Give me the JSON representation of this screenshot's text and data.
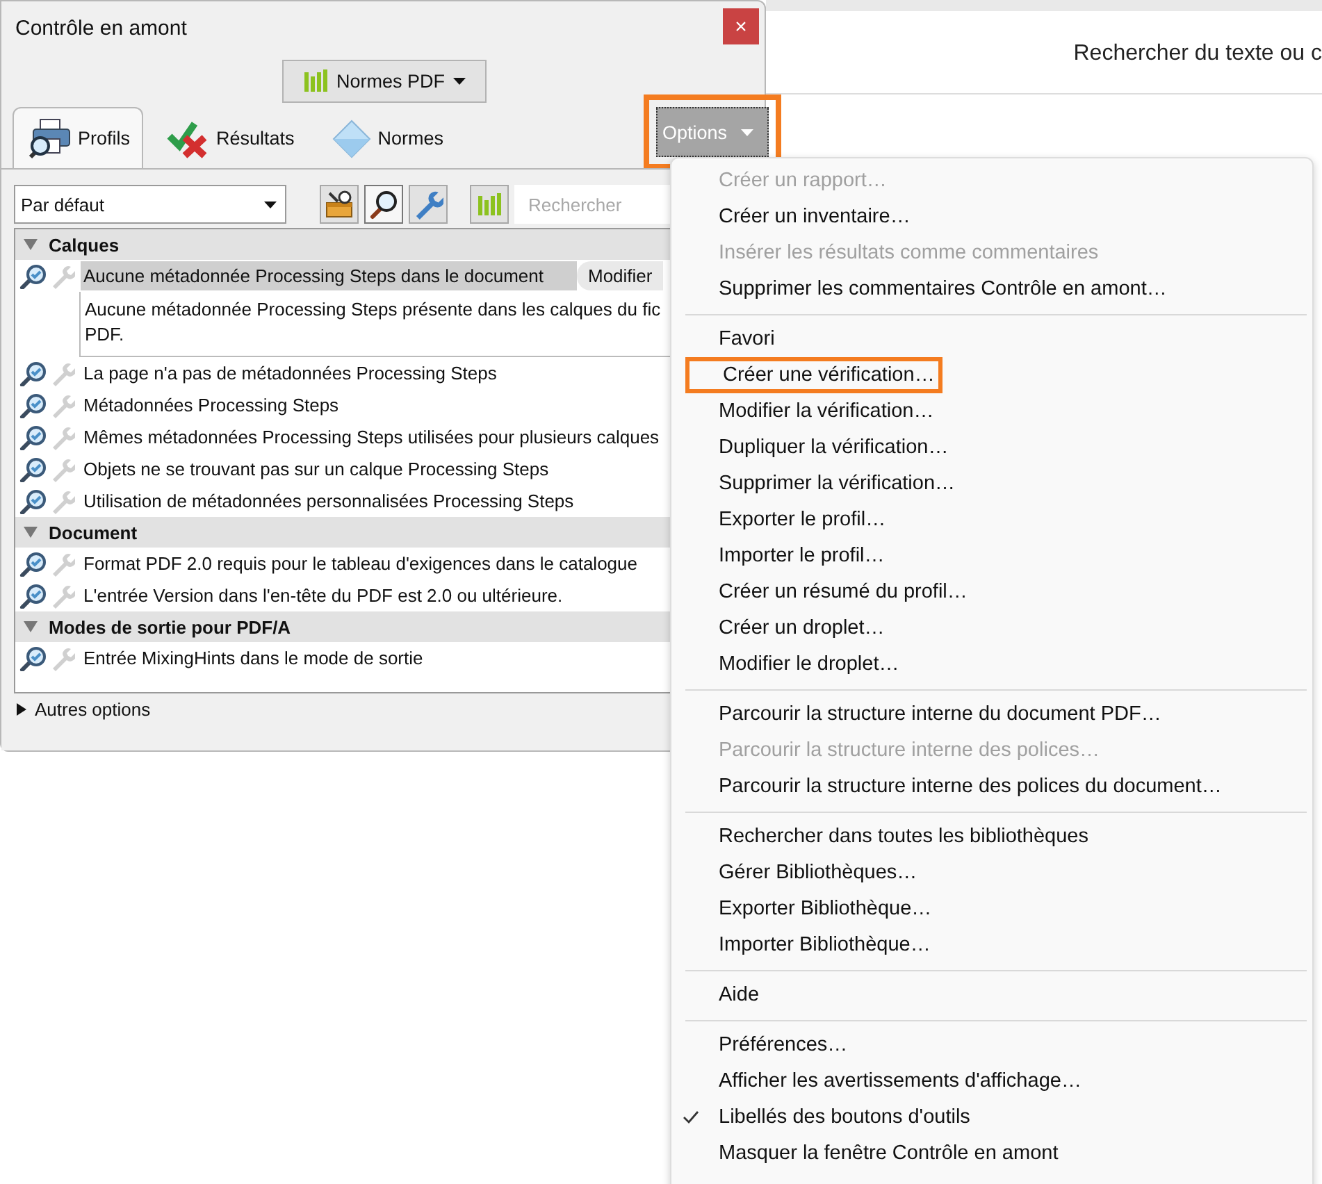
{
  "panel": {
    "title": "Contrôle en amont",
    "close_label": "×",
    "library_button": {
      "label": "Normes PDF"
    },
    "tabs": [
      {
        "label": "Profils",
        "kind": "profiles",
        "selected": true
      },
      {
        "label": "Résultats",
        "kind": "results",
        "selected": false
      },
      {
        "label": "Normes",
        "kind": "standards",
        "selected": false
      }
    ],
    "options_button": {
      "label": "Options",
      "annotated": true
    },
    "profile_select": {
      "value": "Par défaut"
    },
    "toolbar": [
      {
        "kind": "toolbox",
        "selected": false
      },
      {
        "kind": "search",
        "selected": true
      },
      {
        "kind": "wrench",
        "selected": false
      }
    ],
    "search": {
      "placeholder": "Rechercher"
    },
    "groups": [
      {
        "title": "Calques",
        "expanded": true,
        "items": [
          {
            "label": "Aucune métadonnée Processing Steps dans le document",
            "selected": true,
            "action": "Modifier",
            "description_lines": [
              "Aucune métadonnée Processing Steps présente dans les calques du fic",
              "PDF."
            ]
          },
          {
            "label": "La page n'a pas de métadonnées Processing Steps",
            "selected": false
          },
          {
            "label": "Métadonnées Processing Steps",
            "selected": false
          },
          {
            "label": "Mêmes métadonnées Processing Steps utilisées pour plusieurs calques",
            "selected": false
          },
          {
            "label": "Objets ne se trouvant pas sur un calque Processing Steps",
            "selected": false
          },
          {
            "label": "Utilisation de métadonnées personnalisées Processing Steps",
            "selected": false
          }
        ]
      },
      {
        "title": "Document",
        "expanded": true,
        "items": [
          {
            "label": "Format PDF 2.0 requis pour le tableau d'exigences dans le catalogue",
            "selected": false
          },
          {
            "label": "L'entrée Version dans l'en-tête du PDF est 2.0 ou ultérieure.",
            "selected": false
          }
        ]
      },
      {
        "title": "Modes de sortie pour PDF/A",
        "expanded": true,
        "items": [
          {
            "label": "Entrée MixingHints dans le mode de sortie",
            "selected": false
          }
        ]
      }
    ],
    "more_options": {
      "label": "Autres options",
      "expanded": false
    }
  },
  "document": {
    "search_prompt": "Rechercher du texte ou c"
  },
  "menu": {
    "groups": [
      {
        "items": [
          {
            "label": "Créer un rapport…",
            "disabled": true
          },
          {
            "label": "Créer un inventaire…",
            "disabled": false
          },
          {
            "label": "Insérer les résultats comme commentaires",
            "disabled": true
          },
          {
            "label": "Supprimer les commentaires Contrôle en amont…",
            "disabled": false
          }
        ]
      },
      {
        "items": [
          {
            "label": "Favori",
            "disabled": false
          },
          {
            "label": "Créer une vérification…",
            "disabled": false,
            "annotated": true
          },
          {
            "label": "Modifier la vérification…",
            "disabled": false
          },
          {
            "label": "Dupliquer la vérification…",
            "disabled": false
          },
          {
            "label": "Supprimer la vérification…",
            "disabled": false
          },
          {
            "label": "Exporter le profil…",
            "disabled": false
          },
          {
            "label": "Importer le profil…",
            "disabled": false
          },
          {
            "label": "Créer un résumé du profil…",
            "disabled": false
          },
          {
            "label": "Créer un droplet…",
            "disabled": false
          },
          {
            "label": "Modifier le droplet…",
            "disabled": false
          }
        ]
      },
      {
        "items": [
          {
            "label": "Parcourir la structure interne du document PDF…",
            "disabled": false
          },
          {
            "label": "Parcourir la structure interne des polices…",
            "disabled": true
          },
          {
            "label": "Parcourir la structure interne des polices du document…",
            "disabled": false
          }
        ]
      },
      {
        "items": [
          {
            "label": "Rechercher dans toutes les bibliothèques",
            "disabled": false
          },
          {
            "label": "Gérer Bibliothèques…",
            "disabled": false
          },
          {
            "label": "Exporter Bibliothèque…",
            "disabled": false
          },
          {
            "label": "Importer Bibliothèque…",
            "disabled": false
          }
        ]
      },
      {
        "items": [
          {
            "label": "Aide",
            "disabled": false
          }
        ]
      },
      {
        "items": [
          {
            "label": "Préférences…",
            "disabled": false
          },
          {
            "label": "Afficher les avertissements d'affichage…",
            "disabled": false
          },
          {
            "label": "Libellés des boutons d'outils",
            "disabled": false,
            "checked": true
          },
          {
            "label": "Masquer la fenêtre Contrôle en amont",
            "disabled": false
          }
        ]
      }
    ]
  }
}
